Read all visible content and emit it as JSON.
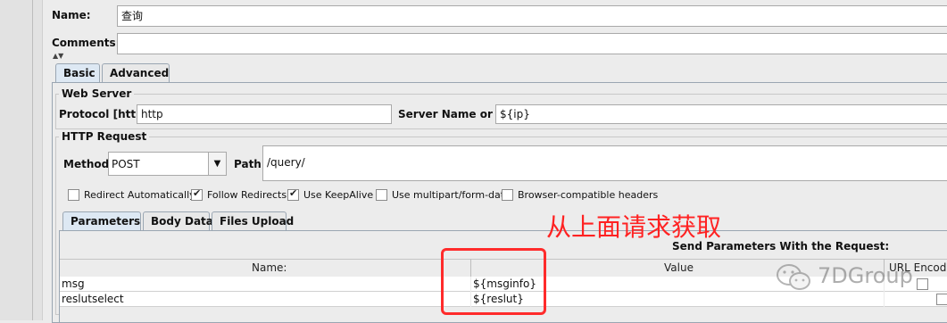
{
  "name": {
    "label": "Name:",
    "value": "查询"
  },
  "comments": {
    "label": "Comments:",
    "value": ""
  },
  "tabs": [
    {
      "label": "Basic"
    },
    {
      "label": "Advanced"
    }
  ],
  "web_server": {
    "legend": "Web Server",
    "protocol_label": "Protocol [http]:",
    "protocol_value": "http",
    "server_label": "Server Name or IP:",
    "server_value": "${ip}"
  },
  "http_request": {
    "legend": "HTTP Request",
    "method_label": "Method:",
    "method_value": "POST",
    "path_label": "Path:",
    "path_value": "/query/"
  },
  "options": [
    {
      "label": "Redirect Automatically",
      "checked": false
    },
    {
      "label": "Follow Redirects",
      "checked": true
    },
    {
      "label": "Use KeepAlive",
      "checked": true
    },
    {
      "label": "Use multipart/form-data",
      "checked": false
    },
    {
      "label": "Browser-compatible headers",
      "checked": false
    }
  ],
  "subtabs": [
    {
      "label": "Parameters"
    },
    {
      "label": "Body Data"
    },
    {
      "label": "Files Upload"
    }
  ],
  "params": {
    "title": "Send Parameters With the Request:",
    "col_name": "Name:",
    "col_value": "Value",
    "col_encode": "URL Encode",
    "rows": [
      {
        "name": "msg",
        "value": "${msginfo}"
      },
      {
        "name": "reslutselect",
        "value": "${reslut}"
      }
    ]
  },
  "annotation": {
    "text": "从上面请求获取",
    "color": "#ff2222"
  },
  "watermark": "7DGroup",
  "colors": {
    "highlight_box": "#ff2b2b",
    "active_tab": "#dde8f3"
  }
}
